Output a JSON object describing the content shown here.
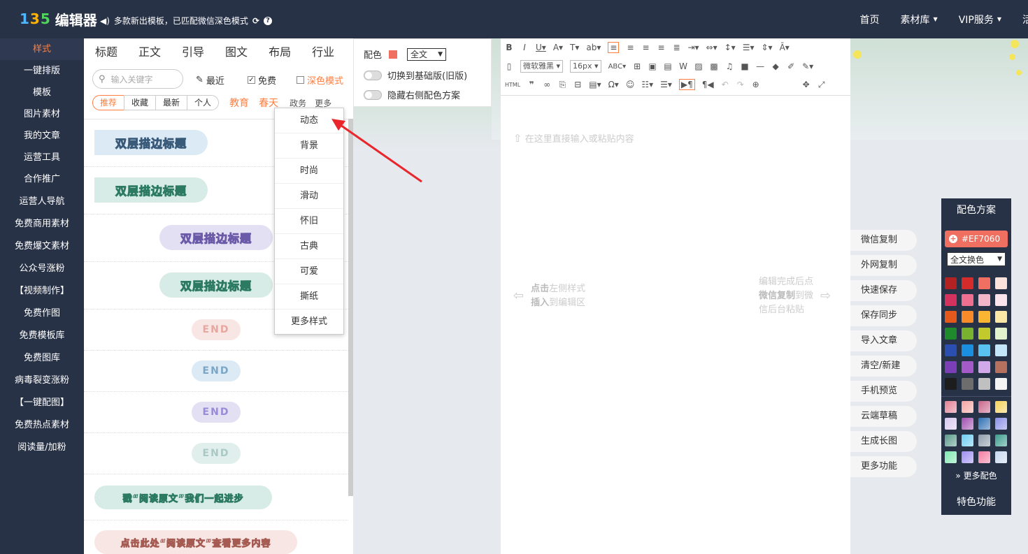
{
  "app": {
    "logo_mark": "135",
    "logo_text": "编辑器",
    "notice": "多款新出模板，已匹配微信深色模式",
    "nav": [
      "首页",
      "素材库",
      "VIP服务",
      "活"
    ]
  },
  "sidebar": {
    "items": [
      "样式",
      "一键排版",
      "模板",
      "图片素材",
      "我的文章",
      "运营工具",
      "合作推广",
      "运营人导航",
      "免费商用素材",
      "免费爆文素材",
      "公众号涨粉",
      "【视频制作】",
      "免费作图",
      "免费模板库",
      "免费图库",
      "病毒裂变涨粉",
      "【一键配图】",
      "免费热点素材",
      "阅读量/加粉"
    ],
    "active": "样式"
  },
  "panel": {
    "categories": [
      "标题",
      "正文",
      "引导",
      "图文",
      "布局",
      "行业"
    ],
    "search_placeholder": "输入关键字",
    "recent_label": "最近",
    "free_label": "免费",
    "dark_label": "深色模式",
    "tabs": [
      "推荐",
      "收藏",
      "最新",
      "个人"
    ],
    "tags_orange": [
      "教育",
      "春天"
    ],
    "tags_gray": [
      "政务",
      "更多"
    ],
    "styles": {
      "title1": "双层描边标题",
      "title2": "双层描边标题",
      "title3": "双层描边标题",
      "title4": "双层描边标题",
      "end1": "END",
      "end2": "END",
      "end3": "END",
      "end4": "END",
      "guide1": "戳“阅读原文”我们一起进步",
      "guide2": "点击此处“阅读原文”查看更多内容"
    }
  },
  "dropdown": {
    "items": [
      "动态",
      "背景",
      "时尚",
      "滑动",
      "怀旧",
      "古典",
      "可爱",
      "撕纸",
      "更多样式"
    ]
  },
  "colorbar": {
    "label": "配色",
    "scope": "全文",
    "toggle1": "切换到基础版(旧版)",
    "toggle2": "隐藏右侧配色方案",
    "swatch": "#EF7060"
  },
  "editor": {
    "font_family": "微软雅黑",
    "font_size": "16px",
    "html_label": "HTML",
    "placeholder": "在这里直接输入或粘贴内容",
    "hint_left_1a": "点击",
    "hint_left_1b": "左侧样式",
    "hint_left_2a": "插入",
    "hint_left_2b": "到编辑区",
    "hint_right_1": "编辑完成后点",
    "hint_right_2a": "微信复制",
    "hint_right_2b": "到微",
    "hint_right_3": "信后台粘贴"
  },
  "actions": [
    "微信复制",
    "外网复制",
    "快速保存",
    "保存同步",
    "导入文章",
    "清空/新建",
    "手机预览",
    "云端草稿",
    "生成长图",
    "更多功能"
  ],
  "scheme": {
    "title": "配色方案",
    "current": "#EF7060",
    "scope": "全文换色",
    "colors": [
      "#b22222",
      "#d62b2b",
      "#ef7060",
      "#fbe3dc",
      "#d3325f",
      "#ee6f8f",
      "#f3b5c8",
      "#fbe4ec",
      "#e2591b",
      "#f98a2a",
      "#fbb531",
      "#fbe8a6",
      "#1e8a2c",
      "#78b22f",
      "#c2c92a",
      "#e1f2cc",
      "#2b4fb0",
      "#1a8fe0",
      "#59c3f1",
      "#c3e7f8",
      "#7a3fb7",
      "#a55ac9",
      "#d1a8e8",
      "#b5715d",
      "#1d1d1d",
      "#6d6d6d",
      "#c0c0c0",
      "#f3f3f3"
    ],
    "gradients": [
      "#e28094",
      "#f3a5a2",
      "#c8668a",
      "#f4d25a",
      "#d8c8f0",
      "#a14fb0",
      "#2e6fb3",
      "#8a90e8",
      "#5a9a8a",
      "#6ccdf2",
      "#8e9cab",
      "#3a9c8c",
      "#7fe8b0",
      "#9e8ef0",
      "#f27ea0",
      "#c8d8f0"
    ],
    "more": "更多配色",
    "feature": "特色功能"
  }
}
